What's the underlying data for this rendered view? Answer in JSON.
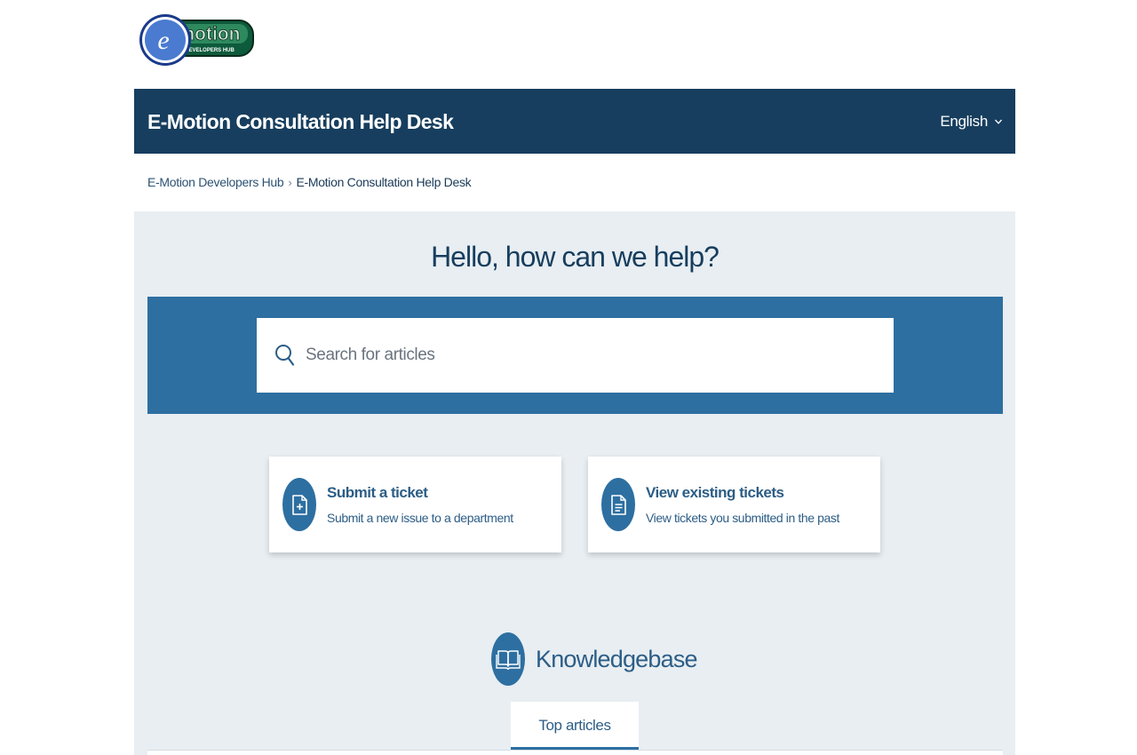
{
  "logo": {
    "icon": "e-motion-logo",
    "text": "-motion",
    "subtext": "DEVELOPERS HUB"
  },
  "header": {
    "title": "E-Motion Consultation Help Desk",
    "language": "English"
  },
  "breadcrumb": {
    "home": "E-Motion Developers Hub",
    "separator": "›",
    "current": "E-Motion Consultation Help Desk"
  },
  "hero": {
    "title": "Hello, how can we help?"
  },
  "search": {
    "placeholder": "Search for articles",
    "value": ""
  },
  "cards": [
    {
      "title": "Submit a ticket",
      "subtitle": "Submit a new issue to a department",
      "icon": "file-plus-icon"
    },
    {
      "title": "View existing tickets",
      "subtitle": "View tickets you submitted in the past",
      "icon": "file-text-icon"
    }
  ],
  "knowledgebase": {
    "title": "Knowledgebase",
    "icon": "open-book-icon",
    "tab": "Top articles"
  },
  "colors": {
    "header_bg": "#173e5e",
    "search_band": "#2d6fa1",
    "main_bg": "#e8eef2",
    "accent": "#2c5d86"
  }
}
